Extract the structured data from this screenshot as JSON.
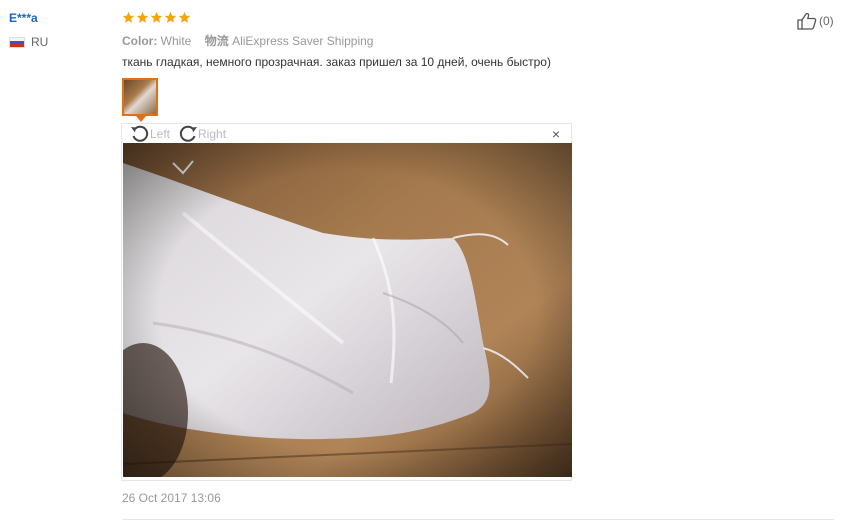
{
  "review": {
    "user_name": "E***a",
    "country": "RU",
    "rating": 5,
    "color_label": "Color:",
    "color_value": "White",
    "shipping_label": "物流",
    "shipping_value": "AliExpress Saver Shipping",
    "text": "ткань гладкая, немного прозрачная. заказ пришел за 10 дней, очень быстро)",
    "date": "26 Oct 2017 13:06"
  },
  "viewer": {
    "rotate_left_label": "Left",
    "rotate_right_label": "Right",
    "close_label": "×"
  },
  "like": {
    "count": "(0)"
  },
  "colors": {
    "user_link": "#1b67b8",
    "star": "#f2a50f",
    "accent": "#e36e14"
  }
}
